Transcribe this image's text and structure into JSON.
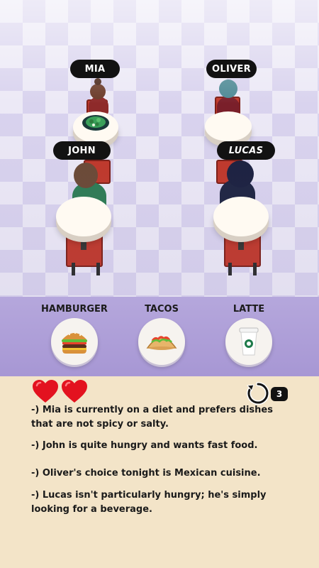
{
  "customers": [
    {
      "name": "MIA",
      "italic": false
    },
    {
      "name": "OLIVER",
      "italic": false
    },
    {
      "name": "JOHN",
      "italic": false
    },
    {
      "name": "LUCAS",
      "italic": true
    }
  ],
  "foods": [
    {
      "label": "HAMBURGER",
      "icon": "hamburger-icon"
    },
    {
      "label": "TACOS",
      "icon": "taco-icon"
    },
    {
      "label": "LATTE",
      "icon": "latte-cup-icon"
    }
  ],
  "lives": 2,
  "undo_count": "3",
  "clues": [
    "-) Mia is currently on a diet and prefers dishes that are not spicy or salty.",
    "-) John is quite hungry and wants fast food.",
    "-) Oliver's choice tonight is Mexican cuisine.",
    "-) Lucas isn't particularly hungry; he's simply looking for a beverage."
  ],
  "colors": {
    "heart": "#e3121f",
    "chair": "#c0392b",
    "shelf": "#a797d4",
    "panel": "#f3e4c8",
    "name_tag": "#121212"
  }
}
